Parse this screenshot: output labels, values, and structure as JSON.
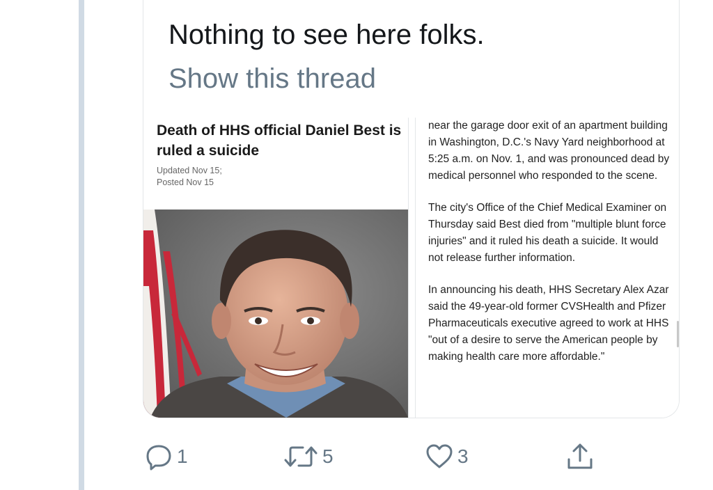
{
  "tweet": {
    "text": "Nothing to see here folks.",
    "show_thread": "Show this thread"
  },
  "article": {
    "title": "Death of HHS official Daniel Best is ruled a suicide",
    "updated": "Updated Nov 15;",
    "posted": "Posted Nov 15",
    "paragraphs": [
      "near the garage door exit of an apartment building in Washington, D.C.'s Navy Yard neighborhood at 5:25 a.m. on Nov. 1, and was pronounced dead by medical personnel who responded to the scene.",
      "The city's Office of the Chief Medical Examiner on Thursday said Best died from \"multiple blunt force injuries\" and it ruled his death a suicide. It would not release further information.",
      "In announcing his death, HHS Secretary Alex Azar said the 49-year-old former CVSHealth and Pfizer Pharmaceuticals executive agreed to work at HHS \"out of a desire to serve the American people by making health care more affordable.\""
    ]
  },
  "actions": {
    "reply_count": "1",
    "retweet_count": "5",
    "like_count": "3"
  },
  "icons": {
    "reply": "reply-icon",
    "retweet": "retweet-icon",
    "like": "heart-icon",
    "share": "share-icon"
  },
  "colors": {
    "text": "#14171a",
    "secondary": "#657786",
    "border": "#e3e6e8"
  }
}
